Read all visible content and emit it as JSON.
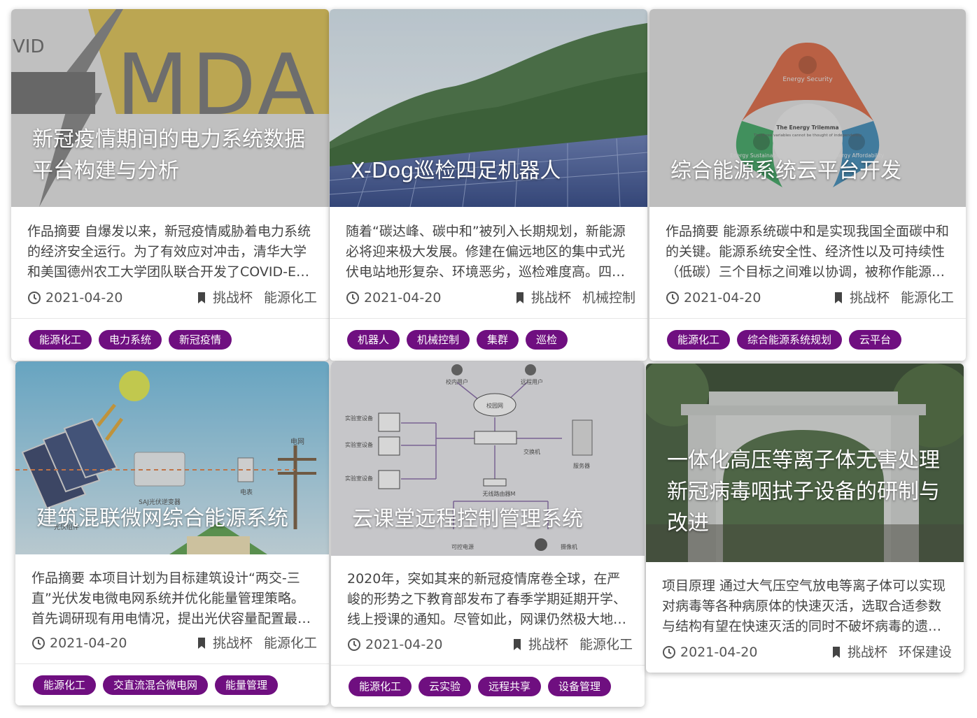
{
  "cards": [
    {
      "title": "新冠疫情期间的电力系统数据平台构建与分析",
      "logo_text": "VID",
      "logo_big": "MDA",
      "abstract": "作品摘要 自爆发以来，新冠疫情威胁着电力系统的经济安全运行。为了有效应对冲击，清华大学和美国德州农工大学团队联合开发了COVID-EMDA电力系统数据平台",
      "date": "2021-04-20",
      "competition": "挑战杯",
      "category": "能源化工",
      "tags": [
        "能源化工",
        "电力系统",
        "新冠疫情"
      ]
    },
    {
      "title": "X-Dog巡检四足机器人",
      "abstract": "随着“碳达峰、碳中和”被列入长期规划，新能源必将迎来极大发展。修建在偏远地区的集中式光伏电站地形复杂、环境恶劣，巡检难度高。四足机器人",
      "date": "2021-04-20",
      "competition": "挑战杯",
      "category": "机械控制",
      "tags": [
        "机器人",
        "机械控制",
        "集群",
        "巡检"
      ]
    },
    {
      "title": "综合能源系统云平台开发",
      "img_labels": {
        "security": "Energy Security",
        "trilemma": "The Energy Trilemma",
        "trilemma_sub": "The three variables cannot be thought of independently",
        "sustain": "Energy Sustainability",
        "afford": "Energy Affordability"
      },
      "abstract": "作品摘要 能源系统碳中和是实现我国全面碳中和的关键。能源系统安全性、经济性以及可持续性（低碳）三个目标之间难以协调，被称作能源不可能三角",
      "date": "2021-04-20",
      "competition": "挑战杯",
      "category": "能源化工",
      "tags": [
        "能源化工",
        "综合能源系统规划",
        "云平台"
      ]
    },
    {
      "title": "建筑混联微网综合能源系统",
      "img_labels": {
        "grid": "电网",
        "inverter": "SAJ光伏逆变器",
        "meter": "电表",
        "panel": "光伏组件"
      },
      "abstract": "作品摘要 本项目计划为目标建筑设计“两交-三直”光伏发电微电网系统并优化能量管理策略。首先调研现有用电情况，提出光伏容量配置最优方案",
      "date": "2021-04-20",
      "competition": "挑战杯",
      "category": "能源化工",
      "tags": [
        "能源化工",
        "交直流混合微电网",
        "能量管理"
      ]
    },
    {
      "title": "云课堂远程控制管理系统",
      "img_labels": {
        "campus_user": "校内用户",
        "remote_user": "远程用户",
        "campus_net": "校园网",
        "lab1": "实验室设备",
        "lab2": "实验室设备",
        "lab3": "实验室设备",
        "switch": "交换机",
        "server": "服务器",
        "router": "无线路由器M",
        "power": "可控电源",
        "camera": "摄像机"
      },
      "abstract": "2020年，突如其来的新冠疫情席卷全球，在严峻的形势之下教育部发布了春季学期延期开学、线上授课的通知。尽管如此，网课仍然极大地阻碍了实验教学",
      "date": "2021-04-20",
      "competition": "挑战杯",
      "category": "能源化工",
      "tags": [
        "能源化工",
        "云实验",
        "远程共享",
        "设备管理"
      ]
    },
    {
      "title": "一体化高压等离子体无害处理新冠病毒咽拭子设备的研制与改进",
      "abstract": "项目原理 通过大气压空气放电等离子体可以实现对病毒等各种病原体的快速灭活，选取合适参数与结构有望在快速灭活的同时不破坏病毒的遗传物质",
      "date": "2021-04-20",
      "competition": "挑战杯",
      "category": "环保建设",
      "tags": []
    }
  ]
}
